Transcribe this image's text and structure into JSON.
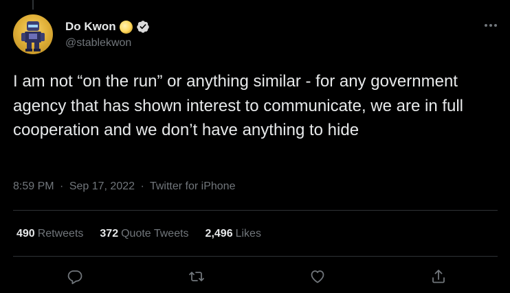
{
  "author": {
    "name": "Do Kwon",
    "handle": "@stablekwon",
    "verified": true,
    "name_badge_icon": "moon-icon"
  },
  "tweet": {
    "text": "I am not “on the run” or anything similar - for any government agency that has shown interest to communicate, we are in full cooperation and we don’t have anything to hide",
    "time": "8:59 PM",
    "date": "Sep 17, 2022",
    "source": "Twitter for iPhone",
    "separator": "·"
  },
  "stats": [
    {
      "count": "490",
      "label": "Retweets"
    },
    {
      "count": "372",
      "label": "Quote Tweets"
    },
    {
      "count": "2,496",
      "label": "Likes"
    }
  ],
  "actions": [
    "reply-icon",
    "retweet-icon",
    "like-icon",
    "share-icon"
  ],
  "colors": {
    "background": "#000000",
    "text_primary": "#e7e9ea",
    "text_secondary": "#71767b",
    "divider": "#2f3336",
    "verified_badge": "#d9d9d9"
  }
}
